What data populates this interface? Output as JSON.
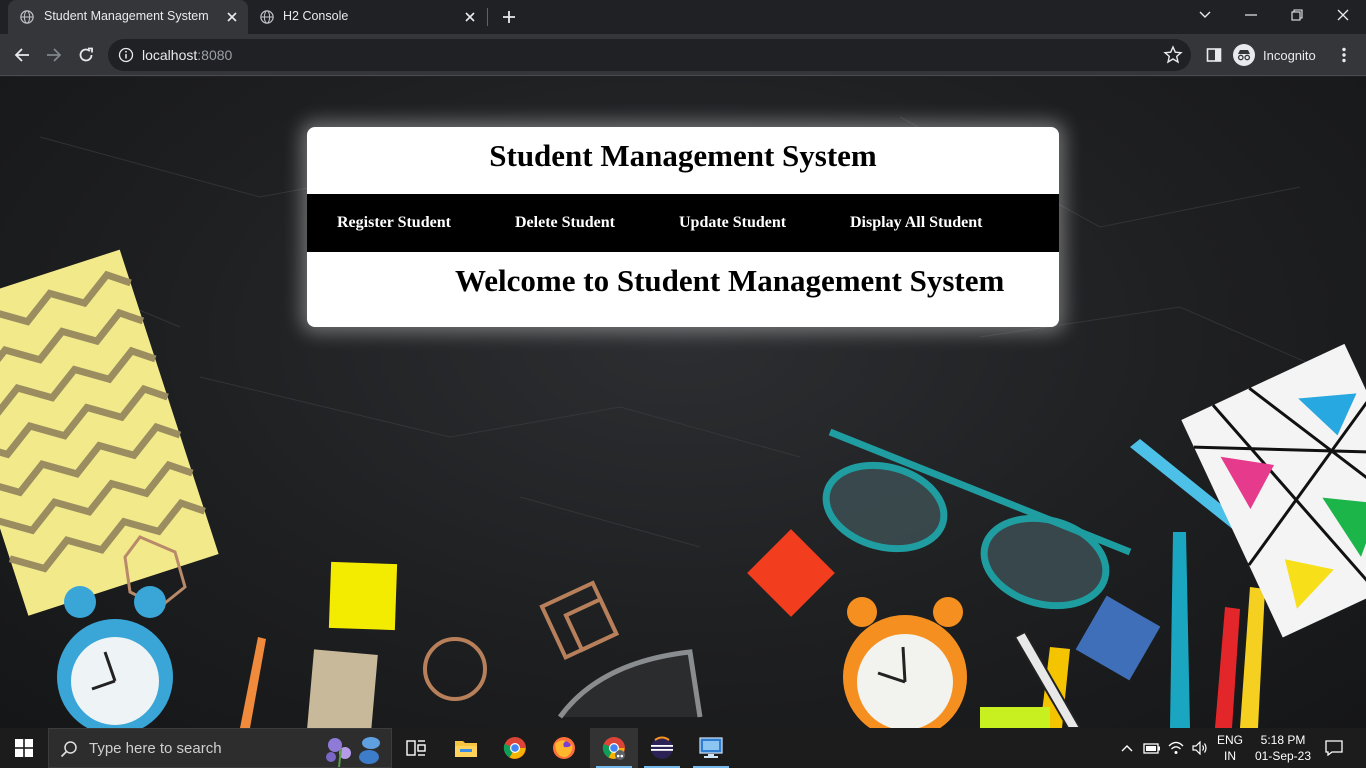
{
  "browser": {
    "tabs": [
      {
        "title": "Student Management System",
        "active": true
      },
      {
        "title": "H2 Console",
        "active": false
      }
    ],
    "url_host": "localhost",
    "url_port": ":8080",
    "profile_label": "Incognito"
  },
  "page": {
    "header_title": "Student Management System",
    "nav": [
      {
        "label": "Register Student"
      },
      {
        "label": "Delete Student"
      },
      {
        "label": "Update Student"
      },
      {
        "label": "Display All Student"
      }
    ],
    "welcome": "Welcome to Student Management System"
  },
  "taskbar": {
    "search_placeholder": "Type here to search",
    "apps": [
      "task-view",
      "file-explorer",
      "chrome",
      "firefox",
      "chrome-incognito",
      "eclipse",
      "remote-desktop"
    ],
    "lang_line1": "ENG",
    "lang_line2": "IN",
    "time": "5:18 PM",
    "date": "01-Sep-23"
  },
  "colors": {
    "tabstrip": "#202124",
    "toolbar": "#35363a",
    "nav_bar": "#000000",
    "card": "#ffffff",
    "taskbar": "#1c1c1c"
  }
}
